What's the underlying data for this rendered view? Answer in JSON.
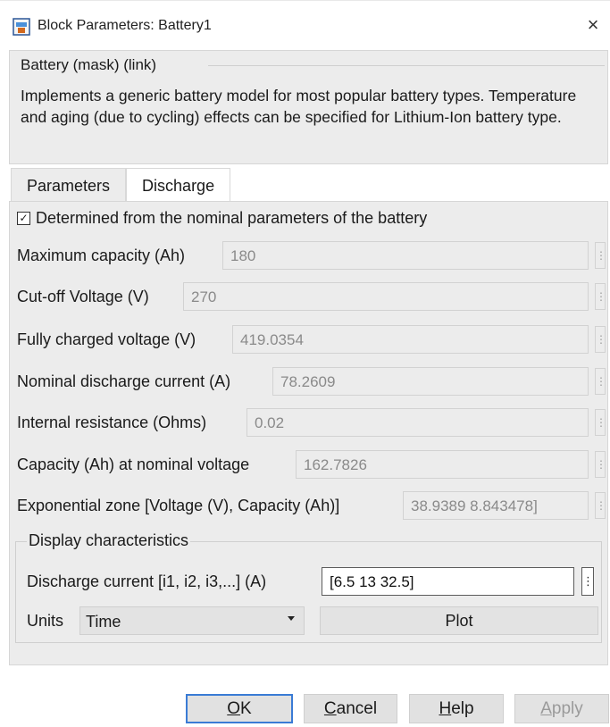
{
  "window": {
    "title": "Block Parameters: Battery1",
    "close_glyph": "×"
  },
  "description": {
    "heading": "Battery (mask) (link)",
    "text": "Implements a generic battery model for most popular battery types. Temperature and aging (due to cycling) effects can be specified for Lithium-Ion battery type."
  },
  "tabs": [
    {
      "label": "Parameters",
      "active": false
    },
    {
      "label": "Discharge",
      "active": true
    }
  ],
  "checkbox": {
    "label": "Determined from the nominal parameters of the battery",
    "checked": true,
    "glyph": "✓"
  },
  "params": [
    {
      "label": "Maximum capacity (Ah)",
      "value": "180"
    },
    {
      "label": "Cut-off Voltage (V)",
      "value": "270"
    },
    {
      "label": "Fully charged voltage (V)",
      "value": "419.0354"
    },
    {
      "label": "Nominal discharge current (A)",
      "value": "78.2609"
    },
    {
      "label": "Internal resistance (Ohms)",
      "value": "0.02"
    },
    {
      "label": "Capacity (Ah) at nominal voltage",
      "value": "162.7826"
    },
    {
      "label": "Exponential zone [Voltage (V), Capacity (Ah)]",
      "value": "38.9389     8.843478]"
    }
  ],
  "display": {
    "group_title": "Display characteristics",
    "discharge_label": "Discharge current [i1, i2, i3,...] (A)",
    "discharge_value": "[6.5 13 32.5]",
    "units_label": "Units",
    "units_value": "Time",
    "plot_label": "Plot",
    "dots_glyph": "⋮"
  },
  "buttons": {
    "ok": {
      "mnemonic": "O",
      "rest": "K"
    },
    "cancel": {
      "mnemonic": "C",
      "rest": "ancel"
    },
    "help": {
      "mnemonic": "H",
      "rest": "elp"
    },
    "apply": {
      "mnemonic": "A",
      "rest": "pply",
      "enabled": false
    }
  },
  "colors": {
    "accent": "#3a7bd5",
    "panel_bg": "#ececec",
    "disabled_text": "#9a9a9a"
  },
  "icons": {
    "app": "simulink-block-icon",
    "close": "close-icon",
    "dots": "more-options-icon",
    "caret": "chevron-down-icon"
  }
}
